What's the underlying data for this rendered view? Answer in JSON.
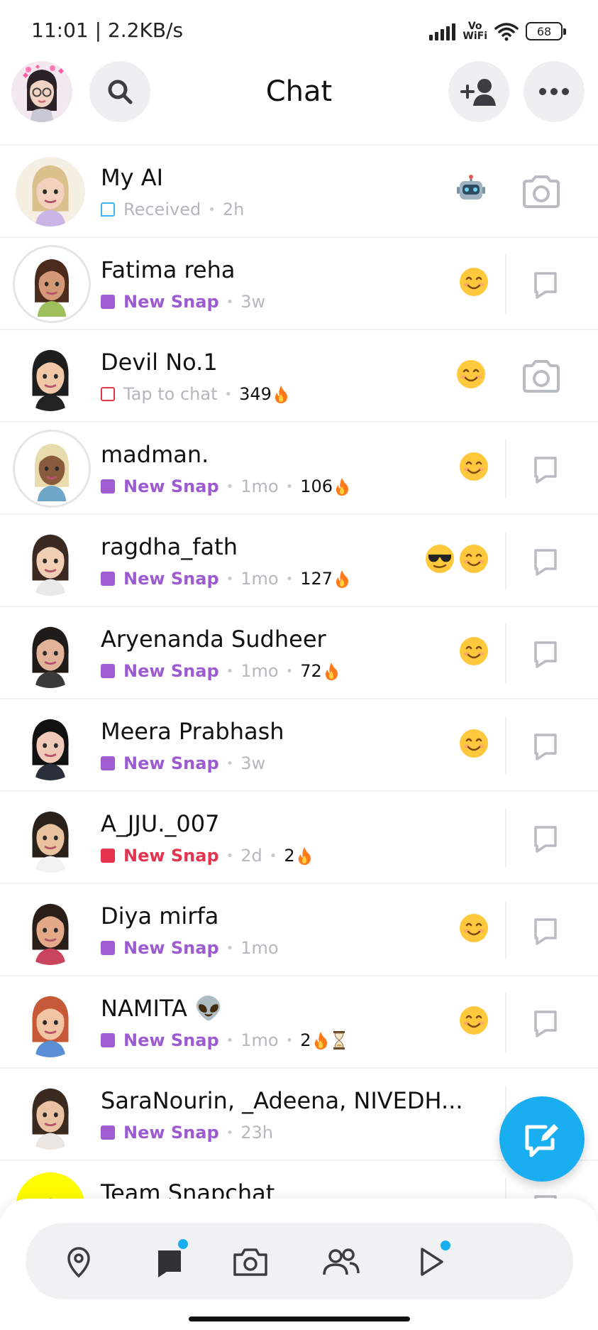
{
  "status_bar": {
    "time": "11:01 | 2.2KB/s",
    "network_label_top": "Vo",
    "network_label_bottom": "WiFi",
    "battery": "68"
  },
  "header": {
    "title": "Chat",
    "avatar_icon": "bitmoji-avatar",
    "search_icon": "search-icon",
    "add_friend_icon": "add-friend-icon",
    "more_icon": "more-icon"
  },
  "chats": [
    {
      "name": "My AI",
      "status": "Received",
      "time": "2h",
      "streak": "",
      "emojis": [
        "robot"
      ],
      "action": "camera",
      "status_style": "blue"
    },
    {
      "name": "Fatima reha",
      "status": "New Snap",
      "time": "3w",
      "streak": "",
      "emojis": [
        "smile"
      ],
      "action": "chat",
      "status_style": "purple"
    },
    {
      "name": "Devil No.1",
      "status": "Tap to chat",
      "time": "",
      "streak": "349",
      "emojis": [
        "smile"
      ],
      "action": "camera",
      "status_style": "tap"
    },
    {
      "name": "madman.",
      "status": "New Snap",
      "time": "1mo",
      "streak": "106",
      "emojis": [
        "smile"
      ],
      "action": "chat",
      "status_style": "purple"
    },
    {
      "name": "ragdha_fath",
      "status": "New Snap",
      "time": "1mo",
      "streak": "127",
      "emojis": [
        "sunglasses",
        "smile"
      ],
      "action": "chat",
      "status_style": "purple"
    },
    {
      "name": "Aryenanda Sudheer",
      "status": "New Snap",
      "time": "1mo",
      "streak": "72",
      "emojis": [
        "smile"
      ],
      "action": "chat",
      "status_style": "purple"
    },
    {
      "name": "Meera Prabhash",
      "status": "New Snap",
      "time": "3w",
      "streak": "",
      "emojis": [
        "smile"
      ],
      "action": "chat",
      "status_style": "purple"
    },
    {
      "name": "A_JJU._007",
      "status": "New Snap",
      "time": "2d",
      "streak": "2",
      "emojis": [],
      "action": "chat",
      "status_style": "red"
    },
    {
      "name": "Diya mirfa",
      "status": "New Snap",
      "time": "1mo",
      "streak": "",
      "emojis": [
        "smile"
      ],
      "action": "chat",
      "status_style": "purple"
    },
    {
      "name": "NAMITA 👽",
      "status": "New Snap",
      "time": "1mo",
      "streak": "2",
      "hourglass": true,
      "emojis": [
        "smile"
      ],
      "action": "chat",
      "status_style": "purple"
    },
    {
      "name": "SaraNourin, _Adeena, NIVEDH...",
      "status": "New Snap",
      "time": "23h",
      "streak": "",
      "emojis": [],
      "action": "none",
      "status_style": "purple"
    },
    {
      "name": "Team Snapchat",
      "status": "",
      "time": "",
      "streak": "",
      "emojis": [],
      "action": "chat",
      "status_style": "none"
    }
  ],
  "fab": {
    "icon": "new-chat-icon"
  },
  "bottom_nav": {
    "items": [
      {
        "name": "map",
        "icon": "map-pin-icon",
        "badge": false
      },
      {
        "name": "chat",
        "icon": "chat-icon",
        "badge": true
      },
      {
        "name": "camera",
        "icon": "camera-icon",
        "badge": false
      },
      {
        "name": "stories",
        "icon": "friends-icon",
        "badge": false
      },
      {
        "name": "spotlight",
        "icon": "play-icon",
        "badge": true
      }
    ]
  },
  "colors": {
    "accent_blue": "#19aef0",
    "new_snap_purple": "#9d5bd2",
    "new_snap_red": "#e33550"
  }
}
